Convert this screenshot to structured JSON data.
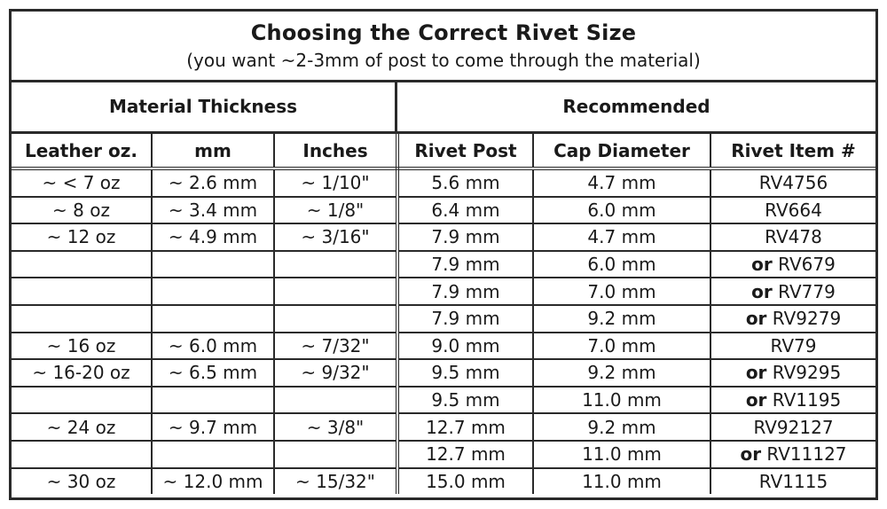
{
  "title": "Choosing the Correct Rivet Size",
  "subtitle": "(you want ~2-3mm of post to come through the material)",
  "sections": {
    "left": "Material Thickness",
    "right": "Recommended"
  },
  "columns": [
    "Leather oz.",
    "mm",
    "Inches",
    "Rivet Post",
    "Cap Diameter",
    "Rivet Item #"
  ],
  "rows": [
    {
      "oz": "~ < 7 oz",
      "mm": "~ 2.6 mm",
      "inches": "~ 1/10\"",
      "post": "5.6 mm",
      "cap": "4.7 mm",
      "or": "",
      "item": "RV4756"
    },
    {
      "oz": "~ 8 oz",
      "mm": "~ 3.4 mm",
      "inches": "~ 1/8\"",
      "post": "6.4 mm",
      "cap": "6.0 mm",
      "or": "",
      "item": "RV664"
    },
    {
      "oz": "~ 12 oz",
      "mm": "~ 4.9 mm",
      "inches": "~ 3/16\"",
      "post": "7.9 mm",
      "cap": "4.7 mm",
      "or": "",
      "item": "RV478"
    },
    {
      "oz": "",
      "mm": "",
      "inches": "",
      "post": "7.9 mm",
      "cap": "6.0 mm",
      "or": "or",
      "item": "RV679"
    },
    {
      "oz": "",
      "mm": "",
      "inches": "",
      "post": "7.9 mm",
      "cap": "7.0 mm",
      "or": "or",
      "item": "RV779"
    },
    {
      "oz": "",
      "mm": "",
      "inches": "",
      "post": "7.9 mm",
      "cap": "9.2 mm",
      "or": "or",
      "item": "RV9279"
    },
    {
      "oz": "~ 16 oz",
      "mm": "~ 6.0 mm",
      "inches": "~ 7/32\"",
      "post": "9.0 mm",
      "cap": "7.0 mm",
      "or": "",
      "item": "RV79"
    },
    {
      "oz": "~ 16-20 oz",
      "mm": "~ 6.5 mm",
      "inches": "~ 9/32\"",
      "post": "9.5 mm",
      "cap": "9.2 mm",
      "or": "or",
      "item": "RV9295"
    },
    {
      "oz": "",
      "mm": "",
      "inches": "",
      "post": "9.5 mm",
      "cap": "11.0 mm",
      "or": "or",
      "item": "RV1195"
    },
    {
      "oz": "~ 24 oz",
      "mm": "~ 9.7 mm",
      "inches": "~ 3/8\"",
      "post": "12.7 mm",
      "cap": "9.2 mm",
      "or": "",
      "item": "RV92127"
    },
    {
      "oz": "",
      "mm": "",
      "inches": "",
      "post": "12.7 mm",
      "cap": "11.0 mm",
      "or": "or",
      "item": "RV11127"
    },
    {
      "oz": "~ 30 oz",
      "mm": "~ 12.0 mm",
      "inches": "~ 15/32\"",
      "post": "15.0 mm",
      "cap": "11.0 mm",
      "or": "",
      "item": "RV1115"
    }
  ]
}
